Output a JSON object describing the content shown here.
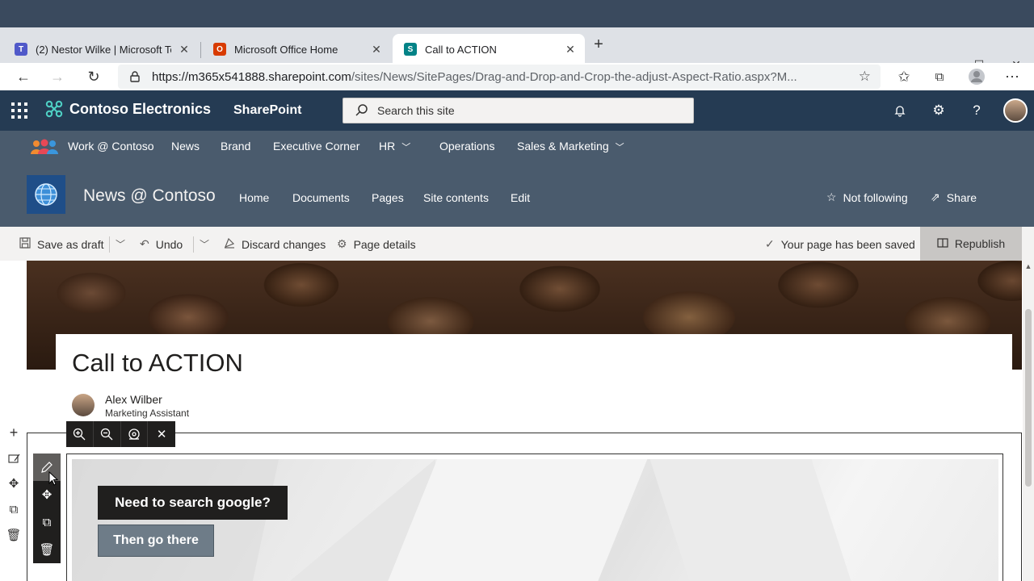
{
  "browser": {
    "tabs": [
      {
        "title": "(2) Nestor Wilke | Microsoft Teams",
        "icon": "teams-icon",
        "active": false
      },
      {
        "title": "Microsoft Office Home",
        "icon": "office-icon",
        "active": false
      },
      {
        "title": "Call to ACTION",
        "icon": "sharepoint-icon",
        "active": true
      }
    ],
    "url_domain": "https://m365x541888.sharepoint.com",
    "url_path": "/sites/News/SitePages/Drag-and-Drop-and-Crop-the-adjust-Aspect-Ratio.aspx?M..."
  },
  "suite": {
    "brand": "Contoso Electronics",
    "app": "SharePoint",
    "search_placeholder": "Search this site"
  },
  "hub": {
    "items": [
      {
        "label": "Work @ Contoso"
      },
      {
        "label": "News"
      },
      {
        "label": "Brand"
      },
      {
        "label": "Executive Corner"
      },
      {
        "label": "HR"
      },
      {
        "label": "Operations"
      },
      {
        "label": "Sales & Marketing"
      }
    ]
  },
  "site": {
    "name": "News @ Contoso",
    "nav": [
      "Home",
      "Documents",
      "Pages",
      "Site contents",
      "Edit"
    ],
    "follow_label": "Not following",
    "share_label": "Share"
  },
  "commandbar": {
    "save_draft": "Save as draft",
    "undo": "Undo",
    "discard": "Discard changes",
    "page_details": "Page details",
    "saved_status": "Your page has been saved",
    "republish": "Republish"
  },
  "page": {
    "title": "Call to ACTION",
    "author_name": "Alex Wilber",
    "author_role": "Marketing Assistant"
  },
  "hero": {
    "heading": "Need to search google?",
    "button": "Then go there"
  },
  "colors": {
    "suite_bar": "#253b53",
    "hub_nav": "#4a5b6d",
    "command_bar": "#f3f2f1"
  }
}
